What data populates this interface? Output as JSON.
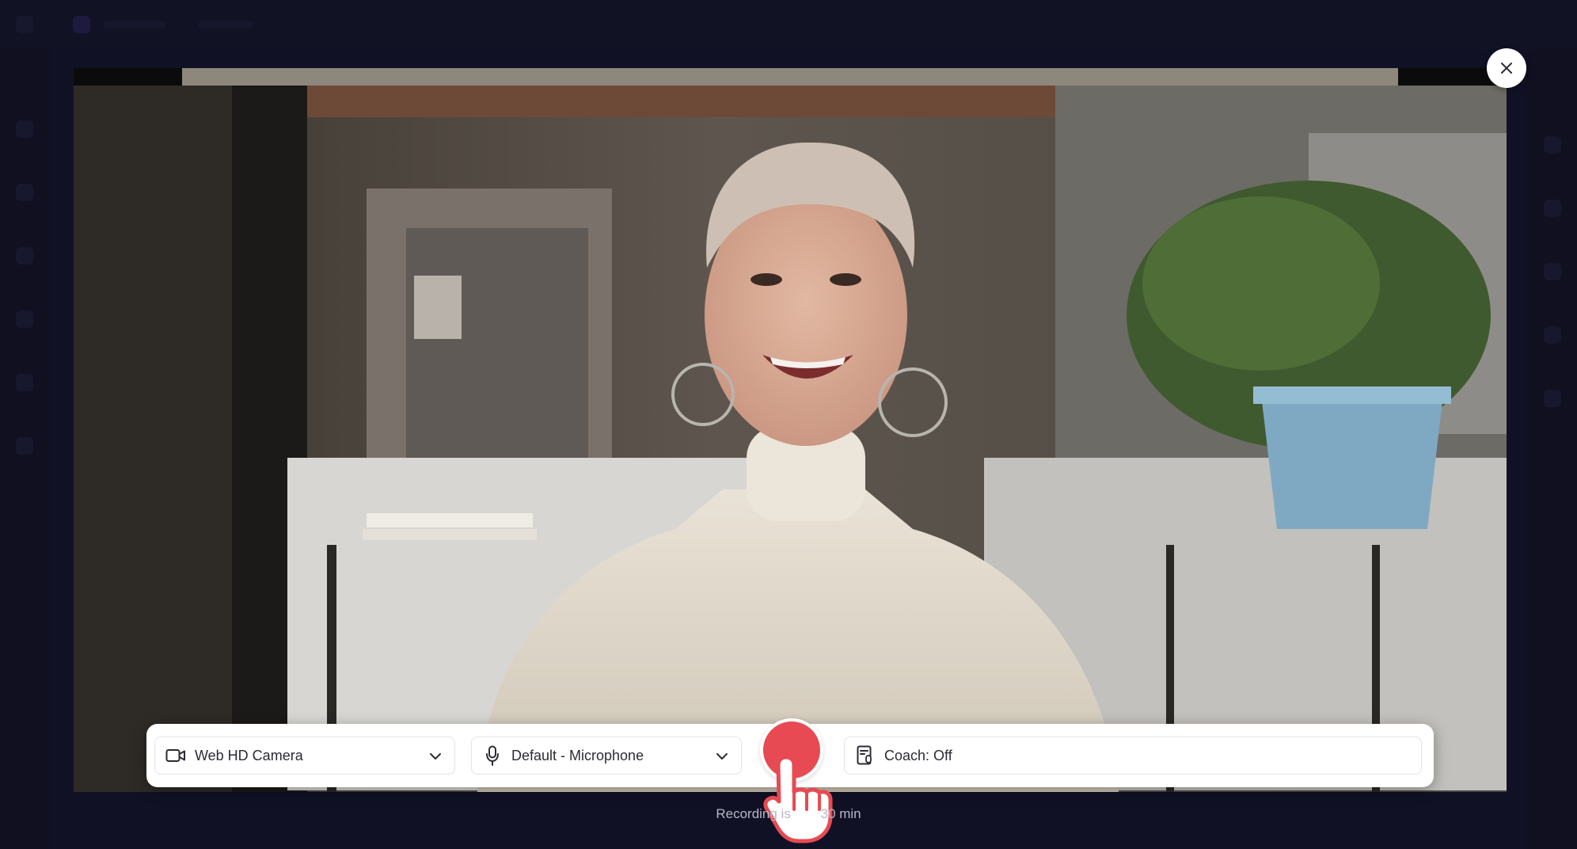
{
  "dialog": {
    "close_label": "close",
    "hint_text": "Recording is        30 min"
  },
  "controls": {
    "camera": {
      "label": "Web HD Camera",
      "icon": "video-camera-icon"
    },
    "microphone": {
      "label": "Default - Microphone",
      "icon": "microphone-icon"
    },
    "record": {
      "icon": "record-icon",
      "color": "#e74a52"
    },
    "coach": {
      "label": "Coach: Off",
      "icon": "speaker-coach-icon"
    }
  },
  "colors": {
    "accent_record": "#e74a52",
    "backdrop": "#161631",
    "bar_bg": "#ffffff"
  }
}
